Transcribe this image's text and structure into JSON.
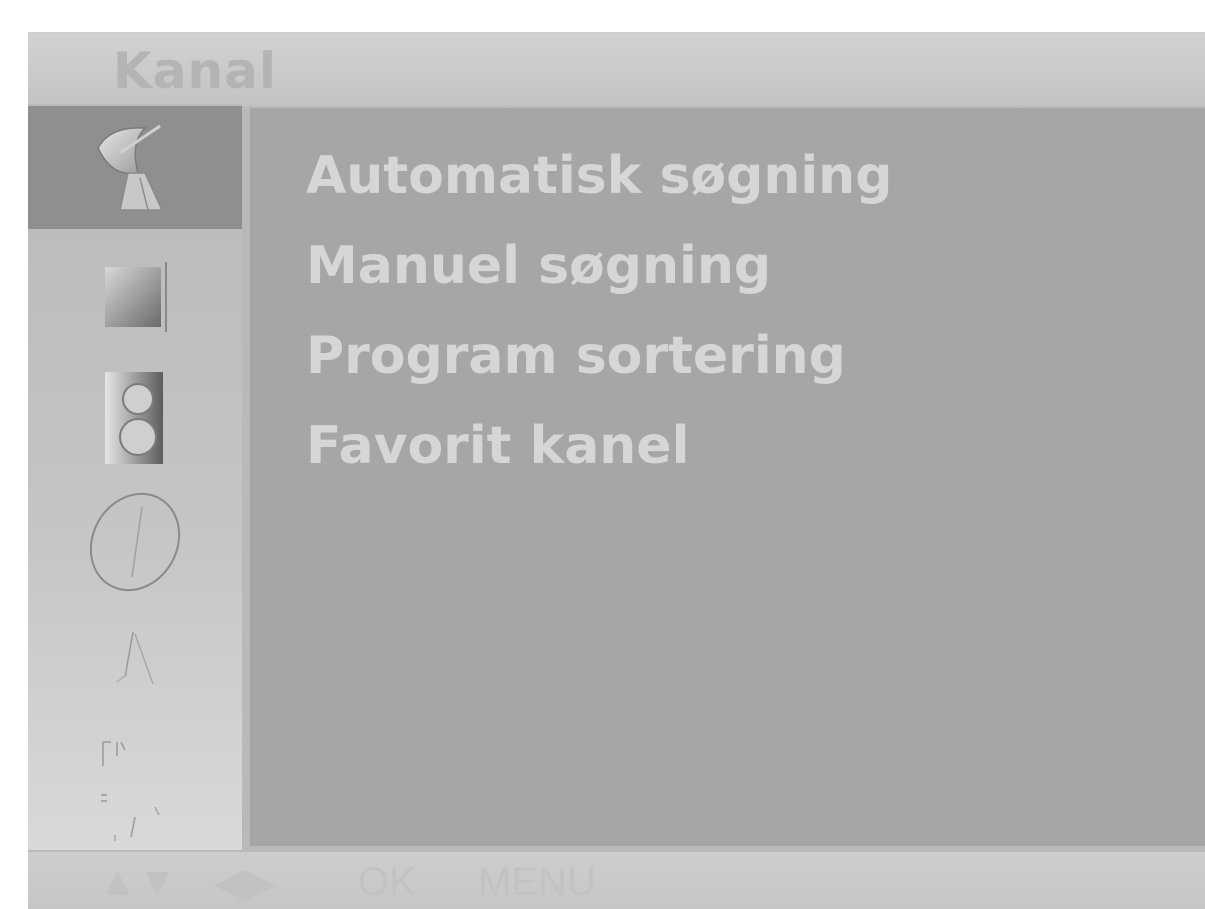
{
  "window": {
    "title": "Kanal"
  },
  "sidebar": {
    "items": [
      {
        "icon": "satellite-dish-icon",
        "selected": true
      },
      {
        "icon": "picture-icon",
        "selected": false
      },
      {
        "icon": "sound-speaker-icon",
        "selected": false
      },
      {
        "icon": "clock-icon",
        "selected": false
      },
      {
        "icon": "setup-triangle-icon",
        "selected": false
      },
      {
        "icon": "input-source-icon",
        "selected": false
      },
      {
        "icon": "lock-icon",
        "selected": false
      }
    ]
  },
  "menu": {
    "items": [
      {
        "label": "Automatisk søgning"
      },
      {
        "label": "Manuel søgning"
      },
      {
        "label": "Program sortering"
      },
      {
        "label": "Favorit kanel"
      }
    ]
  },
  "hints": {
    "ok_label": "OK",
    "menu_label": "MENU",
    "updown_glyph": "▲▼",
    "leftright_glyph": "◀▶"
  },
  "colors": {
    "panel": "#a6a6a6",
    "sidebar_selected": "#8f8f8f",
    "menu_text": "#d6d6d6"
  }
}
